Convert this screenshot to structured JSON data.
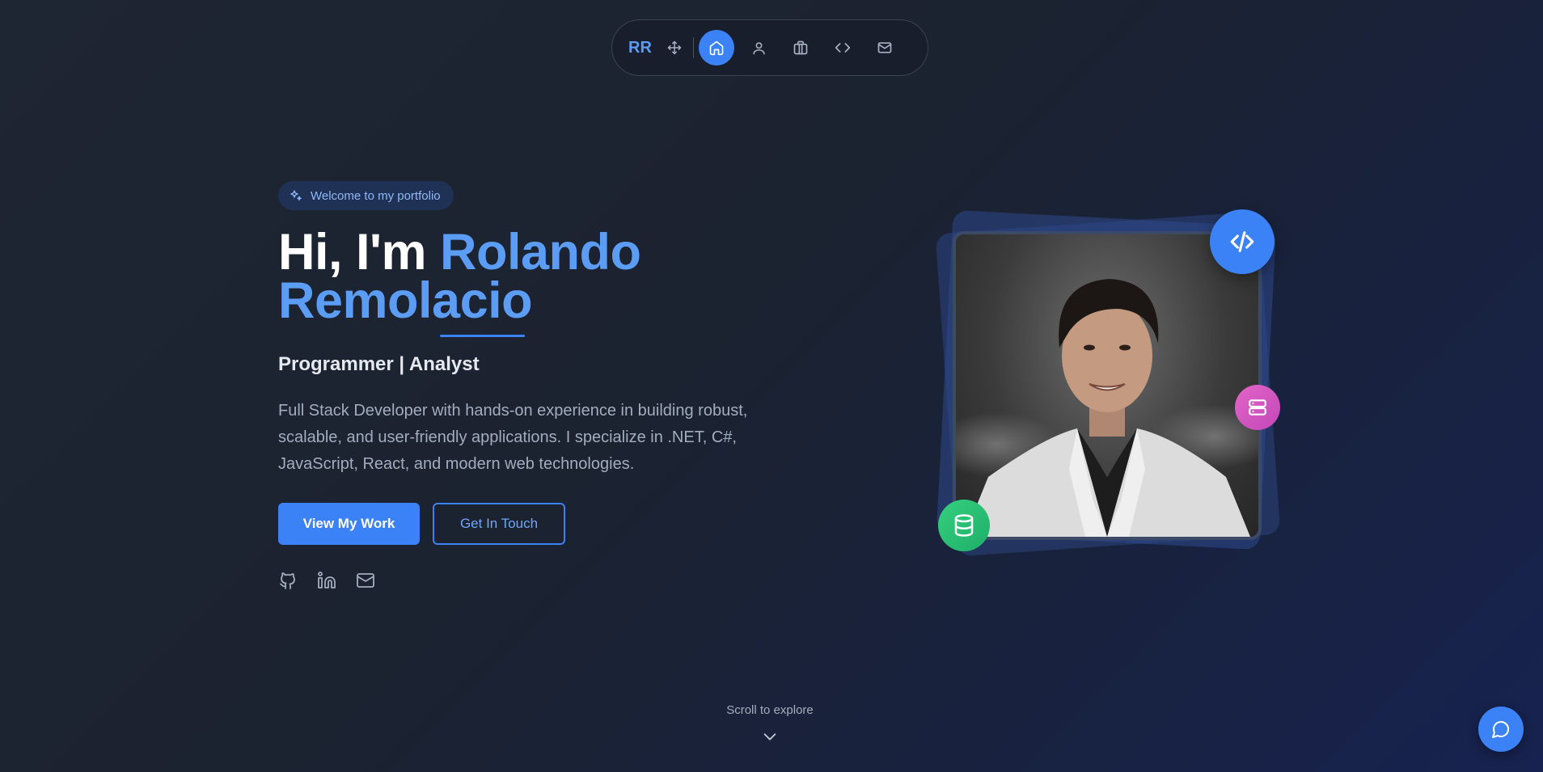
{
  "nav": {
    "brand": "RR",
    "items": [
      {
        "icon": "move-icon"
      },
      {
        "icon": "home-icon",
        "active": true
      },
      {
        "icon": "user-icon"
      },
      {
        "icon": "briefcase-icon"
      },
      {
        "icon": "code-icon"
      },
      {
        "icon": "mail-icon"
      }
    ]
  },
  "hero": {
    "badge": "Welcome to my portfolio",
    "greeting": "Hi, I'm ",
    "name_first": "Rolando",
    "name_last": "Remolacio",
    "role": "Programmer | Analyst",
    "description": "Full Stack Developer with hands-on experience in building robust, scalable, and user-friendly applications. I specialize in .NET, C#, JavaScript, React, and modern web technologies.",
    "primary_button": "View My Work",
    "secondary_button": "Get In Touch",
    "socials": [
      "github-icon",
      "linkedin-icon",
      "mail-icon"
    ]
  },
  "portrait": {
    "floating_icons": [
      "code-icon",
      "server-icon",
      "database-icon"
    ]
  },
  "scroll_hint": "Scroll to explore",
  "colors": {
    "accent": "#3b82f6",
    "accent_text": "#5b9cf5",
    "server_badge": "#d957c0",
    "database_badge": "#28c274"
  }
}
